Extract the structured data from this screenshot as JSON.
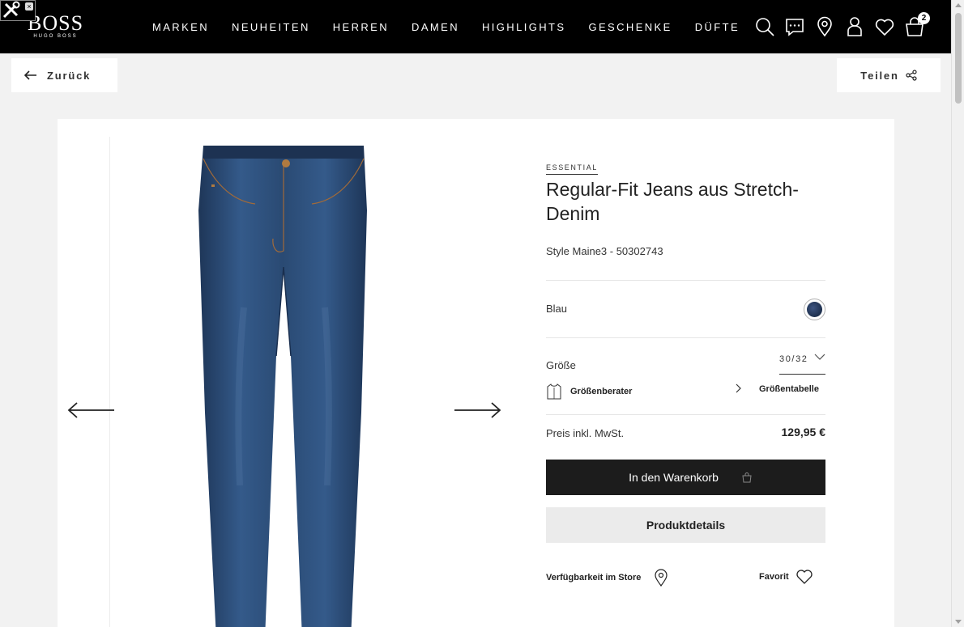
{
  "header": {
    "logo": "BOSS",
    "logo_sub": "HUGO BOSS",
    "nav": [
      "MARKEN",
      "NEUHEITEN",
      "HERREN",
      "DAMEN",
      "HIGHLIGHTS",
      "GESCHENKE",
      "DÜFTE"
    ],
    "cart_count": "2",
    "icons": [
      "search-icon",
      "chat-icon",
      "location-pin-icon",
      "user-icon",
      "heart-icon",
      "shopping-bag-icon"
    ]
  },
  "toolbar": {
    "back_label": "Zurück",
    "share_label": "Teilen"
  },
  "product": {
    "line_label": "ESSENTIAL",
    "title": "Regular-Fit Jeans aus Stretch-Denim",
    "style": "Style Maine3 - 50302743",
    "color_label": "Blau",
    "color_hex": "#23395b",
    "size_label": "Größe",
    "size_value": "30/32",
    "size_advisor_label": "Größenberater",
    "size_table_label": "Größentabelle",
    "price_label": "Preis inkl. MwSt.",
    "price": "129,95 €",
    "add_to_cart_label": "In den Warenkorb",
    "details_label": "Produktdetails",
    "store_label": "Verfügbarkeit im Store",
    "favorite_label": "Favorit"
  },
  "colors": {
    "header_bg": "#000000",
    "page_bg": "#f2f2f2",
    "denim": "#2a4a73",
    "cta_bg": "#1c1c1c"
  }
}
